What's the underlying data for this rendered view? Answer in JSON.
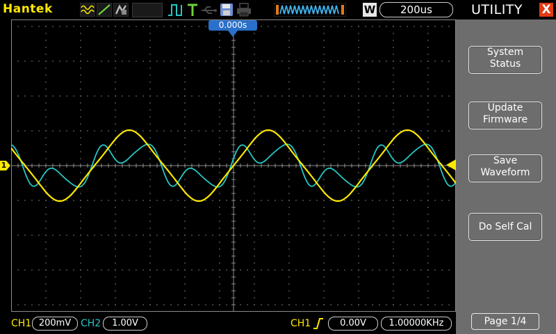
{
  "brand": "Hantek",
  "topbar": {
    "timebase": "200us",
    "mode_letter": "W"
  },
  "trigger_time": "0.000s",
  "bottom": {
    "ch1_label": "CH1",
    "ch1_scale": "200mV",
    "ch2_label": "CH2",
    "ch2_scale": "1.00V",
    "trig_source": "CH1",
    "trig_level": "0.00V",
    "trig_freq": "1.00000KHz"
  },
  "ch1_marker": "1",
  "colors": {
    "ch1": "#ffe800",
    "ch2": "#26c6c6",
    "grid": "#8c8c8c",
    "panel": "#6d6d6d",
    "close": "#e23a12",
    "trigger_badge": "#2a6fc9"
  },
  "panel": {
    "title": "UTILITY",
    "close_label": "X",
    "buttons": [
      {
        "line1": "System",
        "line2": "Status"
      },
      {
        "line1": "Update",
        "line2": "Firmware"
      },
      {
        "line1": "Save",
        "line2": "Waveform"
      },
      {
        "line1": "Do Self Cal",
        "line2": ""
      }
    ],
    "page_label": "Page 1/4"
  }
}
